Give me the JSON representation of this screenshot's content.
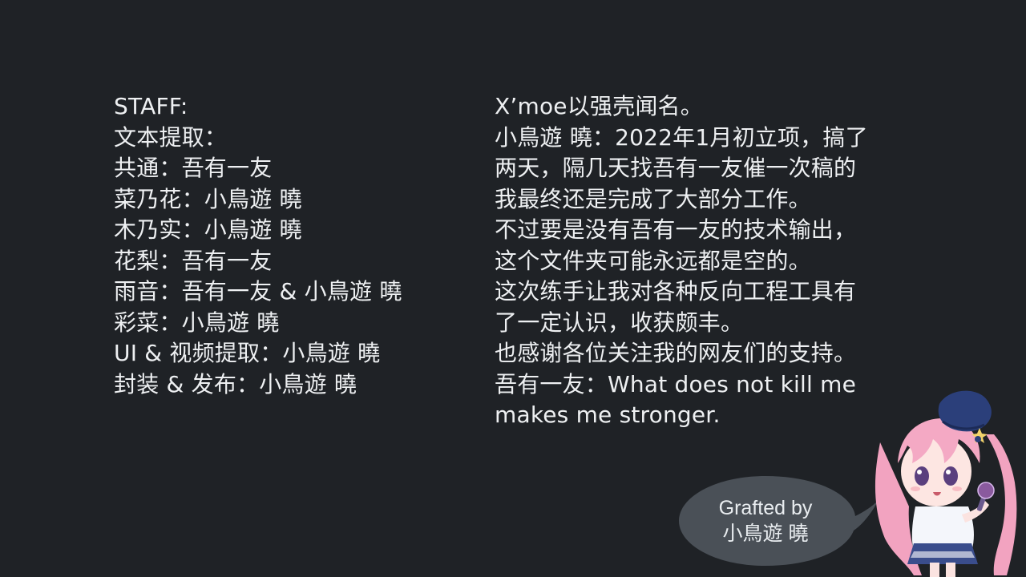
{
  "staff_column": {
    "lines": [
      "STAFF:",
      "文本提取：",
      "共通：吾有一友",
      "菜乃花：小鳥遊 曉",
      "木乃实：小鳥遊 曉",
      "花梨：吾有一友",
      "雨音：吾有一友 & 小鳥遊 曉",
      "彩菜：小鳥遊 曉",
      "UI & 视频提取：小鳥遊 曉",
      "封装 & 发布：小鳥遊 曉"
    ]
  },
  "note_column": {
    "lines": [
      "X’moe以强壳闻名。",
      "小鳥遊 曉：2022年1月初立项，搞了",
      "两天，隔几天找吾有一友催一次稿的",
      "我最终还是完成了大部分工作。",
      "不过要是没有吾有一友的技术输出，",
      "这个文件夹可能永远都是空的。",
      "这次练手让我对各种反向工程工具有",
      "了一定认识，收获颇丰。",
      "也感谢各位关注我的网友们的支持。",
      "吾有一友：What does not kill me",
      "makes me stronger."
    ]
  },
  "speech_bubble": {
    "line1": "Grafted by",
    "line2": "小鳥遊 曉",
    "fill_color": "#4a5057"
  },
  "mascot": {
    "icon": "anime-girl-mascot-icon",
    "hair_color": "#f4a9c4",
    "hat_color": "#2b3f7a"
  },
  "theme": {
    "background": "#1f2226",
    "text_color": "#eef0f2"
  }
}
